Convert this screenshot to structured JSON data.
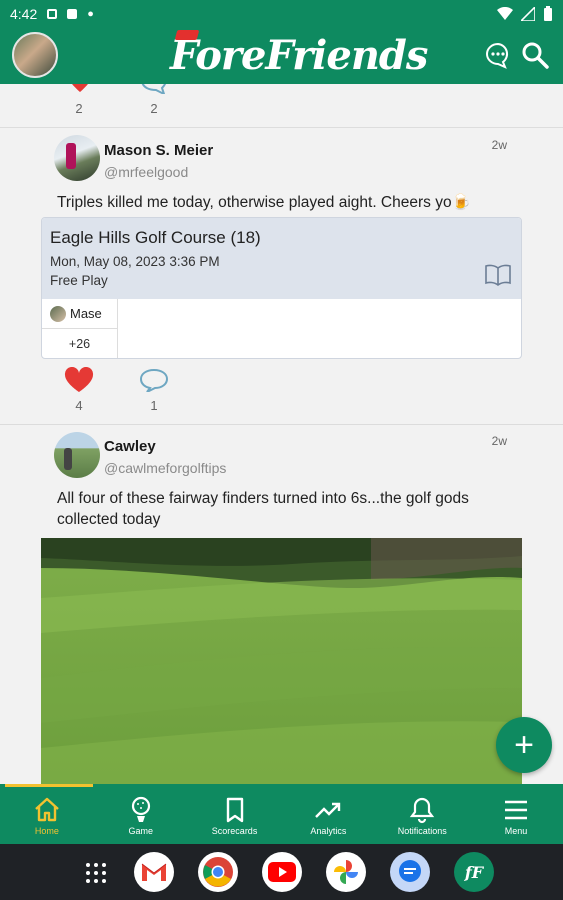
{
  "status_bar": {
    "time": "4:42"
  },
  "app": {
    "logo_text": "ForeFriends",
    "accent": "#0e8a60"
  },
  "prev_post": {
    "likes": "2",
    "comments": "2"
  },
  "posts": [
    {
      "name": "Mason S. Meier",
      "handle": "@mrfeelgood",
      "time": "2w",
      "text": "Triples killed me today, otherwise played aight. Cheers yo🍺",
      "scorecard": {
        "course": "Eagle Hills Golf Course (18)",
        "date": "Mon, May 08, 2023 3:36 PM",
        "mode": "Free Play",
        "player": "Mase",
        "score": "+26"
      },
      "likes": "4",
      "comments": "1"
    },
    {
      "name": "Cawley",
      "handle": "@cawlmeforgolftips",
      "time": "2w",
      "text": "All four of these fairway finders turned into 6s...the golf gods collected today"
    }
  ],
  "fab_label": "+",
  "bottom_nav": [
    {
      "label": "Home",
      "icon": "home-icon"
    },
    {
      "label": "Game",
      "icon": "golf-ball-icon"
    },
    {
      "label": "Scorecards",
      "icon": "bookmark-icon"
    },
    {
      "label": "Analytics",
      "icon": "trending-icon"
    },
    {
      "label": "Notifications",
      "icon": "bell-icon"
    },
    {
      "label": "Menu",
      "icon": "hamburger-icon"
    }
  ],
  "dock_apps": [
    "Gmail",
    "Chrome",
    "YouTube",
    "Photos",
    "Messages",
    "ForeFriends"
  ]
}
